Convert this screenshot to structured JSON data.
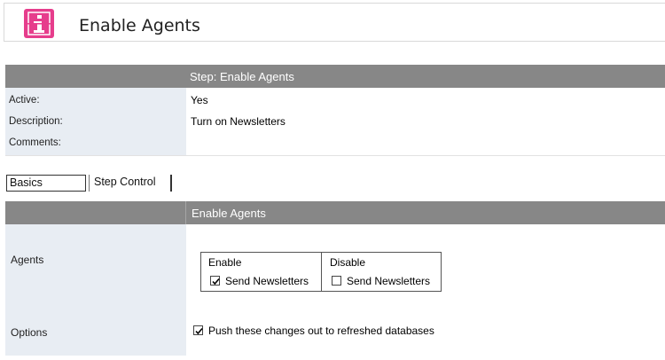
{
  "header": {
    "title": "Enable Agents",
    "logo_icon": "info-icon",
    "logo_color": "#e63d8c"
  },
  "step": {
    "heading": "Step:  Enable Agents",
    "rows": [
      {
        "label": "Active:",
        "value": "Yes"
      },
      {
        "label": "Description:",
        "value": "Turn on Newsletters"
      },
      {
        "label": "Comments:",
        "value": ""
      }
    ]
  },
  "tabs": [
    {
      "label": "Basics",
      "selected": true
    },
    {
      "label": "Step Control",
      "selected": false
    }
  ],
  "section": {
    "heading": "Enable Agents",
    "agents_label": "Agents",
    "options_label": "Options",
    "enable": {
      "header": "Enable",
      "item": "Send Newsletters",
      "checked": true
    },
    "disable": {
      "header": "Disable",
      "item": "Send Newsletters",
      "checked": false
    },
    "push_option": {
      "label": "Push these changes out to refreshed databases",
      "checked": true
    }
  },
  "colors": {
    "header_bar": "#878787",
    "label_column": "#e8edf3"
  }
}
